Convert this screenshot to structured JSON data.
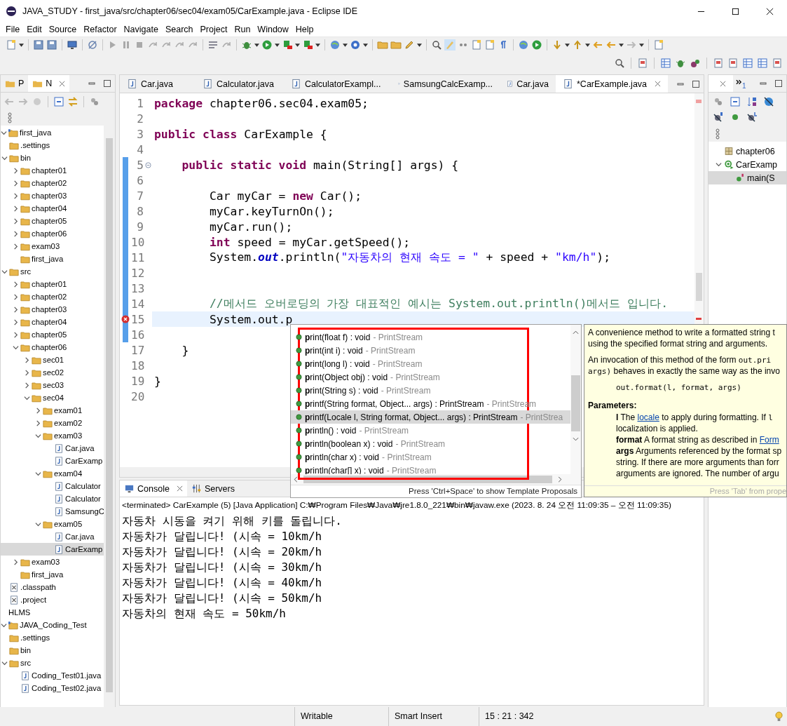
{
  "window": {
    "title": "JAVA_STUDY - first_java/src/chapter06/sec04/exam05/CarExample.java - Eclipse IDE"
  },
  "menu": [
    "File",
    "Edit",
    "Source",
    "Refactor",
    "Navigate",
    "Search",
    "Project",
    "Run",
    "Window",
    "Help"
  ],
  "left_panel": {
    "tabs": [
      {
        "label": "P",
        "selected": false
      },
      {
        "label": "N",
        "selected": true
      }
    ],
    "tree": [
      {
        "label": "first_java",
        "kind": "project",
        "expanded": true,
        "selected": false,
        "children": [
          {
            "label": ".settings",
            "kind": "folder",
            "selected": false
          },
          {
            "label": "bin",
            "kind": "folder",
            "expanded": true,
            "selected": false,
            "children": [
              {
                "label": "chapter01",
                "kind": "folder",
                "expanded": false,
                "selected": false
              },
              {
                "label": "chapter02",
                "kind": "folder",
                "expanded": false,
                "selected": false
              },
              {
                "label": "chapter03",
                "kind": "folder",
                "expanded": false,
                "selected": false
              },
              {
                "label": "chapter04",
                "kind": "folder",
                "expanded": false,
                "selected": false
              },
              {
                "label": "chapter05",
                "kind": "folder",
                "expanded": false,
                "selected": false
              },
              {
                "label": "chapter06",
                "kind": "folder",
                "expanded": false,
                "selected": false
              },
              {
                "label": "exam03",
                "kind": "folder",
                "expanded": false,
                "selected": false
              },
              {
                "label": "first_java",
                "kind": "folder",
                "selected": false
              }
            ]
          },
          {
            "label": "src",
            "kind": "folder",
            "expanded": true,
            "selected": false,
            "children": [
              {
                "label": "chapter01",
                "kind": "folder",
                "expanded": false,
                "selected": false
              },
              {
                "label": "chapter02",
                "kind": "folder",
                "expanded": false,
                "selected": false
              },
              {
                "label": "chapter03",
                "kind": "folder",
                "expanded": false,
                "selected": false
              },
              {
                "label": "chapter04",
                "kind": "folder",
                "expanded": false,
                "selected": false
              },
              {
                "label": "chapter05",
                "kind": "folder",
                "expanded": false,
                "selected": false
              },
              {
                "label": "chapter06",
                "kind": "folder",
                "expanded": true,
                "selected": false,
                "children": [
                  {
                    "label": "sec01",
                    "kind": "folder",
                    "expanded": false,
                    "selected": false
                  },
                  {
                    "label": "sec02",
                    "kind": "folder",
                    "expanded": false,
                    "selected": false
                  },
                  {
                    "label": "sec03",
                    "kind": "folder",
                    "expanded": false,
                    "selected": false
                  },
                  {
                    "label": "sec04",
                    "kind": "folder",
                    "expanded": true,
                    "selected": false,
                    "children": [
                      {
                        "label": "exam01",
                        "kind": "folder",
                        "expanded": false,
                        "selected": false
                      },
                      {
                        "label": "exam02",
                        "kind": "folder",
                        "expanded": false,
                        "selected": false
                      },
                      {
                        "label": "exam03",
                        "kind": "folder",
                        "expanded": true,
                        "selected": false,
                        "children": [
                          {
                            "label": "Car.java",
                            "kind": "java",
                            "selected": false
                          },
                          {
                            "label": "CarExamp",
                            "kind": "java",
                            "selected": false
                          }
                        ]
                      },
                      {
                        "label": "exam04",
                        "kind": "folder",
                        "expanded": true,
                        "selected": false,
                        "children": [
                          {
                            "label": "Calculator",
                            "kind": "java",
                            "selected": false
                          },
                          {
                            "label": "Calculator",
                            "kind": "java",
                            "selected": false
                          },
                          {
                            "label": "SamsungC",
                            "kind": "java",
                            "selected": false
                          }
                        ]
                      },
                      {
                        "label": "exam05",
                        "kind": "folder",
                        "expanded": true,
                        "selected": false,
                        "children": [
                          {
                            "label": "Car.java",
                            "kind": "java",
                            "selected": false
                          },
                          {
                            "label": "CarExamp",
                            "kind": "java",
                            "selected": true
                          }
                        ]
                      }
                    ]
                  }
                ]
              },
              {
                "label": "exam03",
                "kind": "folder",
                "expanded": false,
                "selected": false
              },
              {
                "label": "first_java",
                "kind": "folder",
                "selected": false
              }
            ]
          },
          {
            "label": ".classpath",
            "kind": "xml",
            "selected": false
          },
          {
            "label": ".project",
            "kind": "xml",
            "selected": false
          }
        ]
      },
      {
        "label": "HLMS",
        "kind": "plain",
        "selected": false
      },
      {
        "label": "JAVA_Coding_Test",
        "kind": "project",
        "expanded": true,
        "selected": false,
        "children": [
          {
            "label": ".settings",
            "kind": "folder",
            "selected": false
          },
          {
            "label": "bin",
            "kind": "folder",
            "selected": false
          },
          {
            "label": "src",
            "kind": "folder",
            "expanded": true,
            "selected": false,
            "children": [
              {
                "label": "Coding_Test01.java",
                "kind": "java",
                "selected": false
              },
              {
                "label": "Coding_Test02.java",
                "kind": "java",
                "selected": false
              }
            ]
          }
        ]
      }
    ]
  },
  "editor": {
    "tabs": [
      {
        "label": "Car.java",
        "selected": false
      },
      {
        "label": "Calculator.java",
        "selected": false
      },
      {
        "label": "CalculatorExampl...",
        "selected": false
      },
      {
        "label": "SamsungCalcExamp...",
        "selected": false
      },
      {
        "label": "Car.java",
        "selected": false
      },
      {
        "label": "*CarExample.java",
        "selected": true
      }
    ],
    "lines": [
      {
        "number": "1",
        "segments": [
          {
            "kind": "keyword",
            "text": "package"
          },
          {
            "kind": "plain",
            "text": " chapter06.sec04.exam05;"
          }
        ]
      },
      {
        "number": "2"
      },
      {
        "number": "3",
        "segments": [
          {
            "kind": "keyword",
            "text": "public class"
          },
          {
            "kind": "plain",
            "text": " CarExample {"
          }
        ]
      },
      {
        "number": "4"
      },
      {
        "number": "5",
        "changed": true,
        "foldable": true,
        "segments": [
          {
            "kind": "keyword",
            "text": "    public static void"
          },
          {
            "kind": "plain",
            "text": " main(String[] args) {"
          }
        ]
      },
      {
        "number": "6",
        "changed": true
      },
      {
        "number": "7",
        "changed": true,
        "segments": [
          {
            "kind": "plain",
            "text": "        Car myCar = "
          },
          {
            "kind": "keyword",
            "text": "new"
          },
          {
            "kind": "plain",
            "text": " Car();"
          }
        ]
      },
      {
        "number": "8",
        "changed": true,
        "segments": [
          {
            "kind": "plain",
            "text": "        myCar.keyTurnOn();"
          }
        ]
      },
      {
        "number": "9",
        "changed": true,
        "segments": [
          {
            "kind": "plain",
            "text": "        myCar.run();"
          }
        ]
      },
      {
        "number": "10",
        "changed": true,
        "segments": [
          {
            "kind": "keyword",
            "text": "        int"
          },
          {
            "kind": "plain",
            "text": " speed = myCar.getSpeed();"
          }
        ]
      },
      {
        "number": "11",
        "changed": true,
        "segments": [
          {
            "kind": "plain",
            "text": "        System."
          },
          {
            "kind": "field",
            "text": "out"
          },
          {
            "kind": "plain",
            "text": ".println("
          },
          {
            "kind": "string",
            "text": "\"자동차의 현재 속도 = \""
          },
          {
            "kind": "plain",
            "text": " + speed + "
          },
          {
            "kind": "string",
            "text": "\"km/h\""
          },
          {
            "kind": "plain",
            "text": ");"
          }
        ]
      },
      {
        "number": "12",
        "changed": true
      },
      {
        "number": "13",
        "changed": true
      },
      {
        "number": "14",
        "changed": true,
        "segments": [
          {
            "kind": "comment",
            "text": "        //메서드 오버로딩의 가장 대표적인 예시는 System.out.println()메서드 입니다."
          }
        ]
      },
      {
        "number": "15",
        "changed": true,
        "current": true,
        "error": true,
        "segments": [
          {
            "kind": "plain",
            "text": "        System.out.p"
          }
        ]
      },
      {
        "number": "16",
        "changed": true
      },
      {
        "number": "17",
        "segments": [
          {
            "kind": "plain",
            "text": "    }"
          }
        ]
      },
      {
        "number": "18"
      },
      {
        "number": "19",
        "segments": [
          {
            "kind": "plain",
            "text": "}"
          }
        ]
      },
      {
        "number": "20"
      }
    ]
  },
  "completion": {
    "items": [
      {
        "label": "**p**rint(float f) : void",
        "owner": "- PrintStream",
        "selected": false
      },
      {
        "label": "**p**rint(int i) : void",
        "owner": "- PrintStream",
        "selected": false
      },
      {
        "label": "**p**rint(long l) : void",
        "owner": "- PrintStream",
        "selected": false
      },
      {
        "label": "**p**rint(Object obj) : void",
        "owner": "- PrintStream",
        "selected": false
      },
      {
        "label": "**p**rint(String s) : void",
        "owner": "- PrintStream",
        "selected": false
      },
      {
        "label": "**p**rintf(String format, Object... args) : PrintStream",
        "owner": "- PrintStream",
        "selected": false
      },
      {
        "label": "**p**rintf(Locale l, String format, Object... args) : PrintStream",
        "owner": "- PrintStrea",
        "selected": true
      },
      {
        "label": "**p**rintln() : void",
        "owner": "- PrintStream",
        "selected": false
      },
      {
        "label": "**p**rintln(boolean x) : void",
        "owner": "- PrintStream",
        "selected": false
      },
      {
        "label": "**p**rintln(char x) : void",
        "owner": "- PrintStream",
        "selected": false
      },
      {
        "label": "**p**rintln(char[] x) : void",
        "owner": "- PrintStream",
        "selected": false
      }
    ],
    "footer": "Press 'Ctrl+Space' to show Template Proposals"
  },
  "doc": {
    "blocks": [
      {
        "kind": "paragraph",
        "lines": [
          [
            {
              "kind": "plain",
              "text": "A convenience method to write a formatted string t"
            }
          ],
          [
            {
              "kind": "plain",
              "text": "using the specified format string and arguments."
            }
          ]
        ]
      },
      {
        "kind": "paragraph",
        "lines": [
          [
            {
              "kind": "plain",
              "text": "An invocation of this method of the form "
            },
            {
              "kind": "mono",
              "text": "out.pri"
            }
          ],
          [
            {
              "kind": "mono",
              "text": "args)"
            },
            {
              "kind": "plain",
              "text": " behaves in exactly the same way as the invo"
            }
          ]
        ]
      },
      {
        "kind": "code",
        "lines": [
          [
            {
              "kind": "mono",
              "text": "out.format(l, format, args)"
            }
          ]
        ]
      },
      {
        "kind": "heading",
        "lines": [
          [
            {
              "kind": "bold",
              "text": "Parameters:"
            }
          ]
        ]
      },
      {
        "kind": "params",
        "lines": [
          [
            {
              "kind": "bold",
              "text": "l"
            },
            {
              "kind": "plain",
              "text": " The "
            },
            {
              "kind": "link",
              "text": "locale"
            },
            {
              "kind": "plain",
              "text": " to apply during formatting. If "
            },
            {
              "kind": "mono",
              "text": "l"
            }
          ],
          [
            {
              "kind": "plain",
              "text": "localization is applied."
            }
          ],
          [
            {
              "kind": "bold",
              "text": "format"
            },
            {
              "kind": "plain",
              "text": " A format string as described in "
            },
            {
              "kind": "link",
              "text": "Form"
            }
          ],
          [
            {
              "kind": "bold",
              "text": "args"
            },
            {
              "kind": "plain",
              "text": " Arguments referenced by the format sp"
            }
          ],
          [
            {
              "kind": "plain",
              "text": "string. If there are more arguments than forr"
            }
          ],
          [
            {
              "kind": "plain",
              "text": "arguments are ignored. The number of argu"
            }
          ]
        ]
      }
    ],
    "footer": "Press 'Tab' from prope"
  },
  "console": {
    "tabs": [
      {
        "label": "Console",
        "selected": true
      },
      {
        "label": "Servers",
        "selected": false
      }
    ],
    "header": "<terminated> CarExample (5) [Java Application] C:₩Program Files₩Java₩jre1.8.0_221₩bin₩javaw.exe  (2023. 8. 24 오전 11:09:35 – 오전 11:09:35)",
    "lines": [
      "자동차 시동을 켜기 위해 키를 돌립니다.",
      "자동차가 달립니다! (시속 = 10km/h",
      "자동차가 달립니다! (시속 = 20km/h",
      "자동차가 달립니다! (시속 = 30km/h",
      "자동차가 달립니다! (시속 = 40km/h",
      "자동차가 달립니다! (시속 = 50km/h",
      "자동차의 현재 속도 = 50km/h"
    ]
  },
  "outline": {
    "overflow_count": "1",
    "tree": [
      {
        "label": "chapter06",
        "kind": "package",
        "selected": false
      },
      {
        "label": "CarExamp",
        "kind": "class",
        "expanded": true,
        "selected": false,
        "children": [
          {
            "label": "main(S",
            "kind": "method",
            "selected": true
          }
        ]
      }
    ]
  },
  "status_bar": {
    "cells": [
      "Writable",
      "Smart Insert",
      "15 : 21 : 342"
    ]
  }
}
